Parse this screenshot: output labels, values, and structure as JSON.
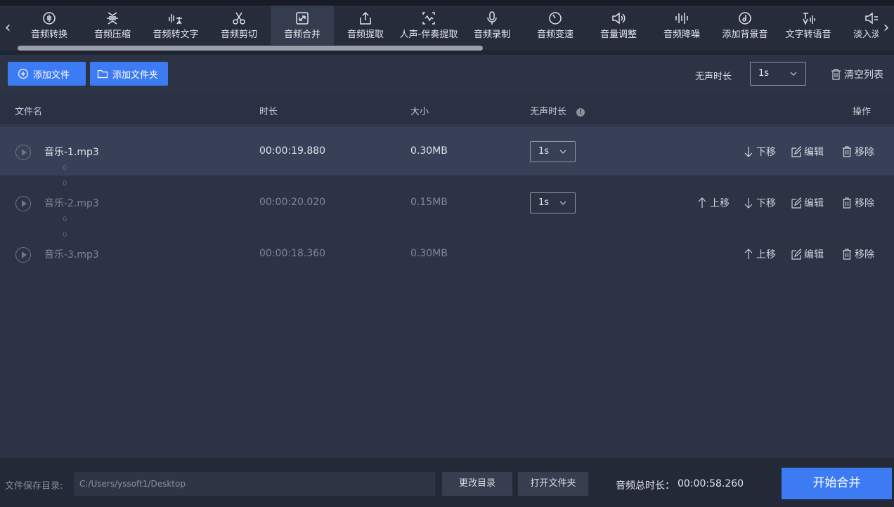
{
  "toolbar": {
    "tools": [
      {
        "label": "音频转换",
        "icon": "audio-convert-icon"
      },
      {
        "label": "音频压缩",
        "icon": "compress-icon"
      },
      {
        "label": "音频转文字",
        "icon": "speech-to-text-icon"
      },
      {
        "label": "音频剪切",
        "icon": "scissors-icon"
      },
      {
        "label": "音频合并",
        "icon": "merge-icon"
      },
      {
        "label": "音频提取",
        "icon": "extract-icon"
      },
      {
        "label": "人声-伴奏提取",
        "icon": "vocal-separate-icon"
      },
      {
        "label": "音频录制",
        "icon": "microphone-icon"
      },
      {
        "label": "音频变速",
        "icon": "speed-icon"
      },
      {
        "label": "音量调整",
        "icon": "volume-icon"
      },
      {
        "label": "音频降噪",
        "icon": "denoise-icon"
      },
      {
        "label": "添加背景音",
        "icon": "background-music-icon"
      },
      {
        "label": "文字转语音",
        "icon": "text-to-speech-icon"
      },
      {
        "label": "淡入淡出",
        "icon": "fade-icon"
      }
    ],
    "active_index": 4,
    "prev_arrow": "‹",
    "next_arrow": "›"
  },
  "actions": {
    "add_file": "添加文件",
    "add_folder": "添加文件夹",
    "silence_label": "无声时长",
    "silence_value": "1s",
    "clear_list": "清空列表"
  },
  "table": {
    "headers": {
      "name": "文件名",
      "duration": "时长",
      "size": "大小",
      "silence": "无声时长",
      "info": "!",
      "operations": "操作"
    },
    "rows": [
      {
        "name": "音乐-1.mp3",
        "duration": "00:00:19.880",
        "size": "0.30MB",
        "silence": "1s"
      },
      {
        "name": "音乐-2.mp3",
        "duration": "00:00:20.020",
        "size": "0.15MB",
        "silence": "1s"
      },
      {
        "name": "音乐-3.mp3",
        "duration": "00:00:18.360",
        "size": "0.30MB",
        "silence": ""
      }
    ],
    "ops": {
      "move_up": "上移",
      "move_down": "下移",
      "edit": "编辑",
      "remove": "移除"
    },
    "gap_mark": "0"
  },
  "footer": {
    "save_label": "文件保存目录:",
    "save_path": "C:/Users/yssoft1/Desktop",
    "change_dir": "更改目录",
    "open_folder": "打开文件夹",
    "total_label": "音频总时长：",
    "total_value": "00:00:58.260",
    "start": "开始合并"
  },
  "colors": {
    "accent": "#3d7bf5",
    "background": "#1f2431",
    "panel": "#2c3344",
    "selected_row": "#374056"
  }
}
